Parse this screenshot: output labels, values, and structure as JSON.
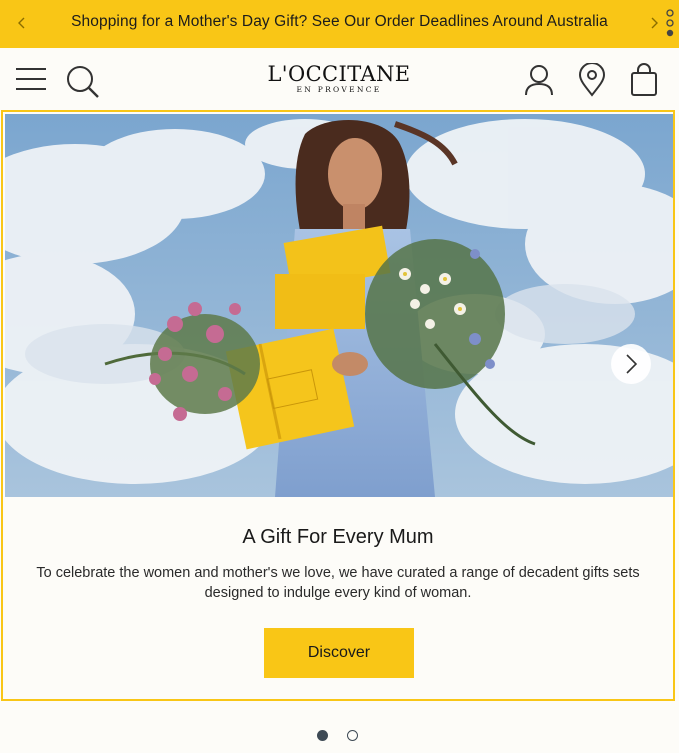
{
  "promo": {
    "text": "Shopping for a Mother's Day Gift? See Our Order Deadlines Around Australia",
    "prev_icon": "chevron-left-icon",
    "next_icon": "chevron-right-icon",
    "accent": "#f9c616"
  },
  "header": {
    "logo_main": "L'OCCITANE",
    "logo_sub": "EN PROVENCE",
    "icons": [
      "menu-icon",
      "search-icon",
      "account-icon",
      "store-locator-icon",
      "bag-icon"
    ]
  },
  "hero": {
    "title": "A Gift For Every Mum",
    "description": "To celebrate the women and mother's we love, we have curated a range of decadent gifts sets designed to indulge every kind of woman.",
    "cta_label": "Discover",
    "next_icon": "chevron-right-icon"
  },
  "carousel": {
    "slide_count": 2,
    "active_slide": 1
  },
  "colors": {
    "brand_yellow": "#f9c616",
    "background": "#fdfcf8",
    "dot": "#3e4a55"
  }
}
